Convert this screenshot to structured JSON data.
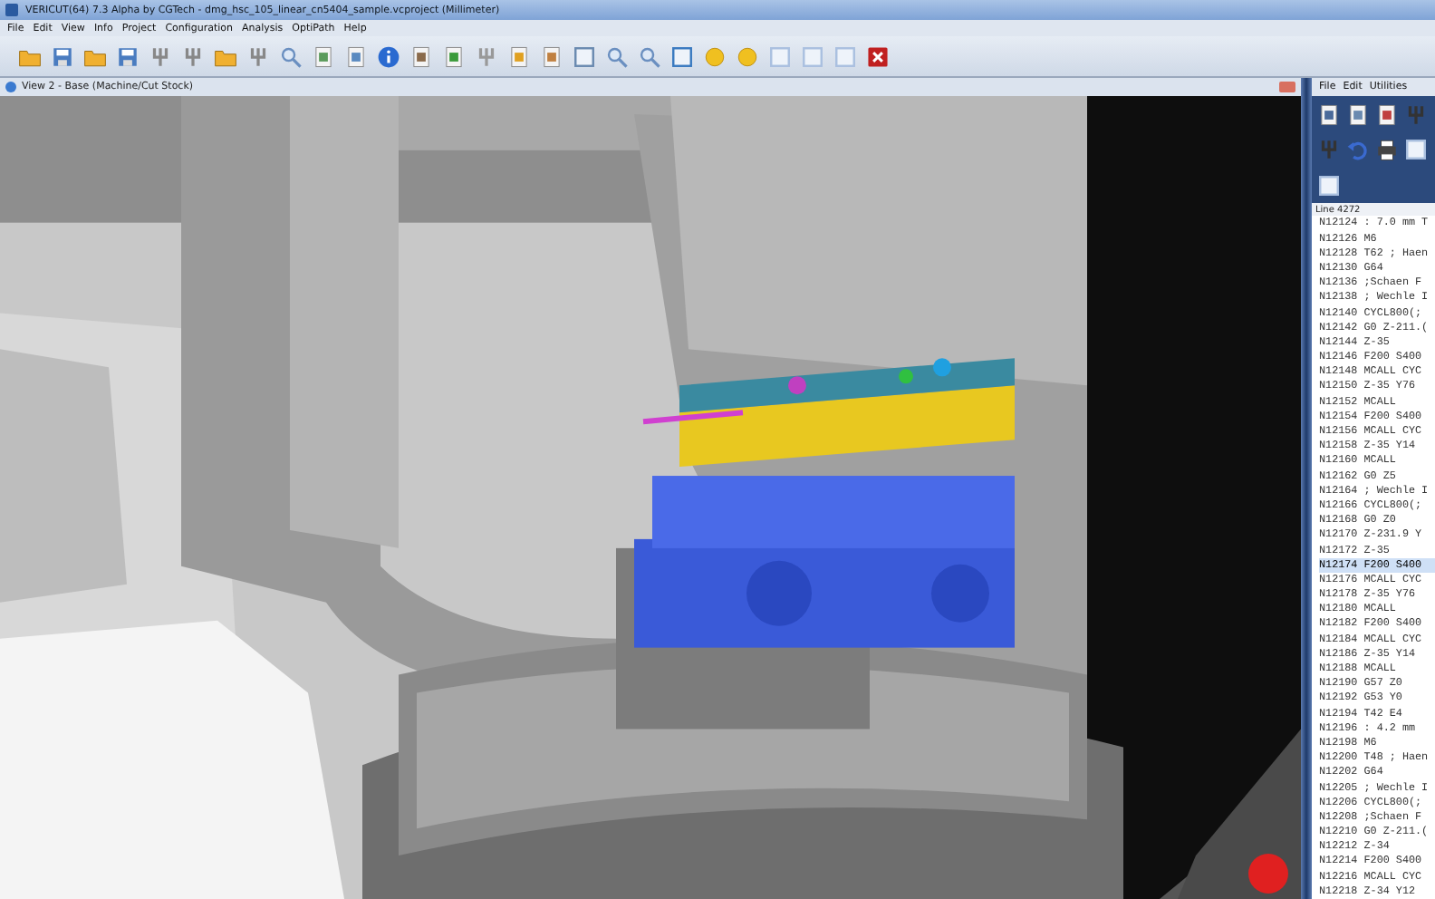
{
  "window": {
    "title": "VERICUT(64)  7.3 Alpha by CGTech - dmg_hsc_105_linear_cn5404_sample.vcproject (Millimeter)"
  },
  "menu": [
    "File",
    "Edit",
    "View",
    "Info",
    "Project",
    "Configuration",
    "Analysis",
    "OptiPath",
    "Help"
  ],
  "view": {
    "title": "View 2 - Base (Machine/Cut Stock)"
  },
  "nc_panel": {
    "menu": [
      "File",
      "Edit",
      "Utilities"
    ],
    "line_label": "Line 4272",
    "lines": [
      {
        "text": "N12124 : 7.0 mm T",
        "selected": false
      },
      {
        "text": "N12126 M6",
        "selected": false
      },
      {
        "text": "N12128 T62 ; Haen",
        "selected": false
      },
      {
        "text": "N12130 G64",
        "selected": false
      },
      {
        "text": "N12136 ;Schaen F",
        "selected": false
      },
      {
        "text": "N12138 ; Wechle I",
        "selected": false
      },
      {
        "text": "N12140 CYCL800(;",
        "selected": false
      },
      {
        "text": "N12142 G0 Z-211.(",
        "selected": false
      },
      {
        "text": "N12144 Z-35",
        "selected": false
      },
      {
        "text": "N12146 F200 S400",
        "selected": false
      },
      {
        "text": "N12148 MCALL CYC",
        "selected": false
      },
      {
        "text": "N12150  Z-35 Y76",
        "selected": false
      },
      {
        "text": "N12152 MCALL",
        "selected": false
      },
      {
        "text": "N12154 F200 S400",
        "selected": false
      },
      {
        "text": "N12156 MCALL CYC",
        "selected": false
      },
      {
        "text": "N12158  Z-35 Y14",
        "selected": false
      },
      {
        "text": "N12160 MCALL",
        "selected": false
      },
      {
        "text": "N12162 G0 Z5",
        "selected": false
      },
      {
        "text": "N12164 ; Wechle I",
        "selected": false
      },
      {
        "text": "N12166 CYCL800(;",
        "selected": false
      },
      {
        "text": "N12168 G0 Z0",
        "selected": false
      },
      {
        "text": "N12170 Z-231.9 Y",
        "selected": false
      },
      {
        "text": "N12172 Z-35",
        "selected": false
      },
      {
        "text": "N12174 F200 S400",
        "selected": true
      },
      {
        "text": "N12176 MCALL CYC",
        "selected": false
      },
      {
        "text": "N12178  Z-35 Y76",
        "selected": false
      },
      {
        "text": "N12180 MCALL",
        "selected": false
      },
      {
        "text": "N12182 F200 S400",
        "selected": false
      },
      {
        "text": "N12184 MCALL CYC",
        "selected": false
      },
      {
        "text": "N12186  Z-35 Y14",
        "selected": false
      },
      {
        "text": "N12188 MCALL",
        "selected": false
      },
      {
        "text": "N12190 G57 Z0",
        "selected": false
      },
      {
        "text": "N12192 G53 Y0",
        "selected": false
      },
      {
        "text": "N12194 T42 E4",
        "selected": false
      },
      {
        "text": "N12196 : 4.2 mm",
        "selected": false
      },
      {
        "text": "N12198 M6",
        "selected": false
      },
      {
        "text": "N12200 T48 ; Haen",
        "selected": false
      },
      {
        "text": "N12202 G64",
        "selected": false
      },
      {
        "text": "N12205 ; Wechle I",
        "selected": false
      },
      {
        "text": "N12206 CYCL800(;",
        "selected": false
      },
      {
        "text": "N12208 ;Schaen F",
        "selected": false
      },
      {
        "text": "N12210 G0 Z-211.(",
        "selected": false
      },
      {
        "text": "N12212 Z-34",
        "selected": false
      },
      {
        "text": "N12214 F200 S400",
        "selected": false
      },
      {
        "text": "N12216 MCALL CYC",
        "selected": false
      },
      {
        "text": "N12218  Z-34 Y12",
        "selected": false
      }
    ]
  }
}
